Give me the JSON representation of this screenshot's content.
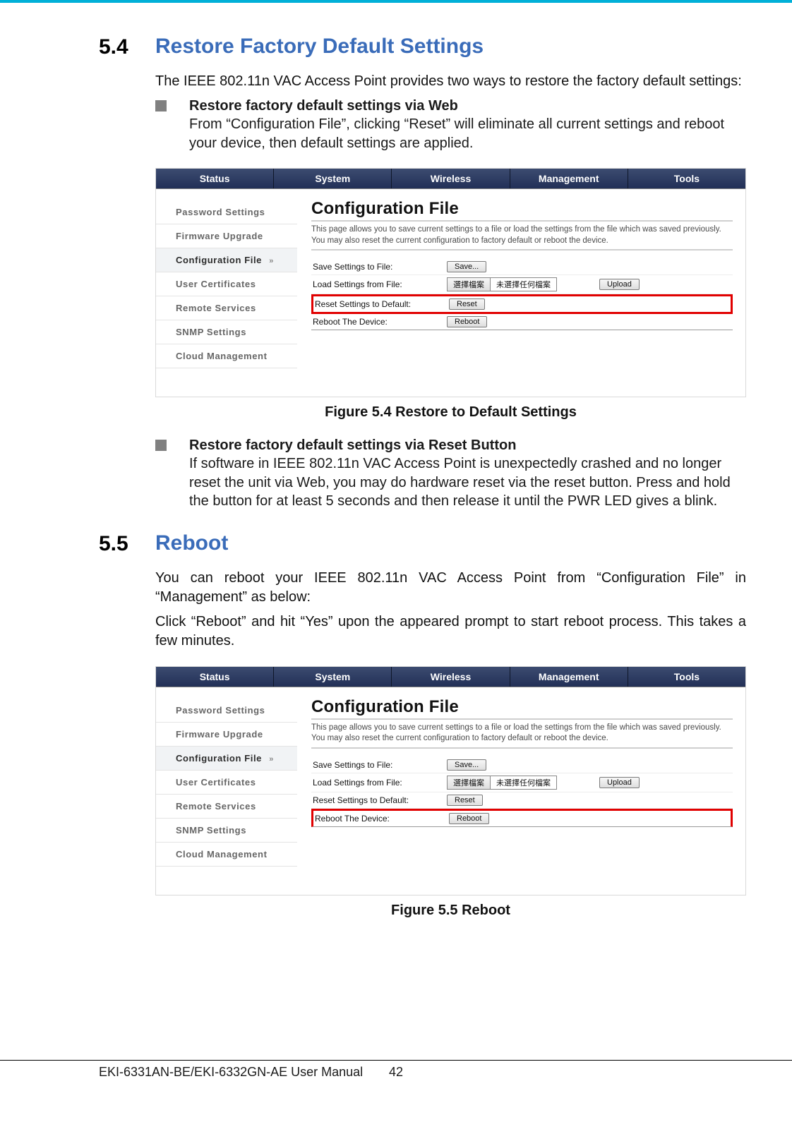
{
  "section54": {
    "number": "5.4",
    "title": "Restore Factory Default Settings",
    "intro": "The IEEE 802.11n VAC Access Point provides two ways to restore the factory default settings:",
    "bullet1_title": "Restore factory default settings via Web",
    "bullet1_desc": "From “Configuration File”, clicking “Reset” will eliminate all current settings and reboot your device, then default settings are applied.",
    "caption": "Figure 5.4 Restore to Default Settings",
    "bullet2_title": "Restore factory default settings via Reset Button",
    "bullet2_desc": "If software in IEEE 802.11n VAC Access Point is unexpectedly crashed and no longer reset the unit via Web, you may do hardware reset via the reset button. Press and hold the button for at least 5 seconds and then release it until the PWR LED gives a blink."
  },
  "section55": {
    "number": "5.5",
    "title": "Reboot",
    "p1": "You can reboot your IEEE 802.11n VAC Access Point from “Configuration File” in “Management” as below:",
    "p2": "Click “Reboot” and hit “Yes” upon the appeared prompt to start reboot process. This takes a few minutes.",
    "caption": "Figure 5.5 Reboot"
  },
  "nav": {
    "t0": "Status",
    "t1": "System",
    "t2": "Wireless",
    "t3": "Management",
    "t4": "Tools"
  },
  "sidebar": {
    "i0": "Password Settings",
    "i1": "Firmware Upgrade",
    "i2": "Configuration File",
    "chev": "»",
    "i3": "User Certificates",
    "i4": "Remote Services",
    "i5": "SNMP Settings",
    "i6": "Cloud Management"
  },
  "panel": {
    "title": "Configuration File",
    "desc": "This page allows you to save current settings to a file or load the settings from the file which was saved previously. You may also reset the current configuration to factory default or reboot the device.",
    "r0": "Save Settings to File:",
    "b_save": "Save...",
    "r1": "Load Settings from File:",
    "fp_btn": "選擇檔案",
    "fp_txt": "未選擇任何檔案",
    "b_upload": "Upload",
    "r2": "Reset Settings to Default:",
    "b_reset": "Reset",
    "r3": "Reboot The Device:",
    "b_reboot": "Reboot"
  },
  "footer": {
    "left": "EKI-6331AN-BE/EKI-6332GN-AE User Manual",
    "page": "42"
  }
}
